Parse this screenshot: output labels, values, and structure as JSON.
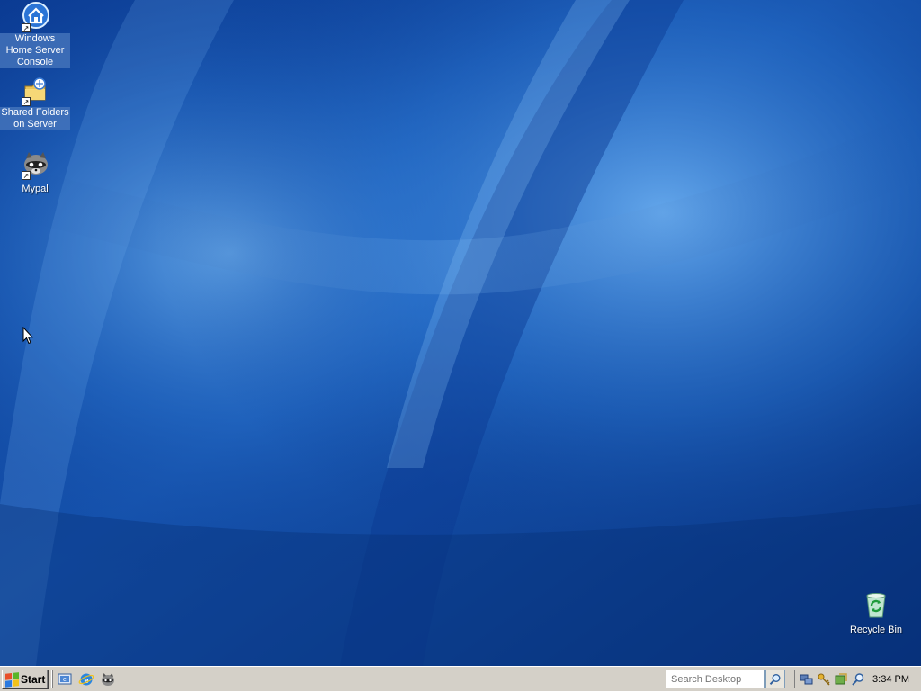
{
  "desktop": {
    "icons": [
      {
        "label": "Windows Home Server Console",
        "icon": "home-server-icon",
        "selected": true
      },
      {
        "label": "Shared Folders on Server",
        "icon": "shared-folders-icon",
        "selected": true
      },
      {
        "label": "Mypal",
        "icon": "mypal-raccoon-icon",
        "selected": false
      },
      {
        "label": "Recycle Bin",
        "icon": "recycle-bin-icon",
        "selected": false
      }
    ],
    "wallpaper_colors": {
      "dark": "#062f7a",
      "mid": "#1a5fbf",
      "light": "#6fb2f0"
    }
  },
  "taskbar": {
    "start_label": "Start",
    "quick_launch": [
      "desktop-show-icon",
      "internet-explorer-icon",
      "mypal-raccoon-icon"
    ],
    "search_placeholder": "Search Desktop",
    "tray_icons": [
      "network-icon",
      "security-keys-icon",
      "server-status-icon",
      "search-tray-icon"
    ],
    "clock": "3:34 PM",
    "colors": {
      "background": "#d4d0c8"
    }
  }
}
